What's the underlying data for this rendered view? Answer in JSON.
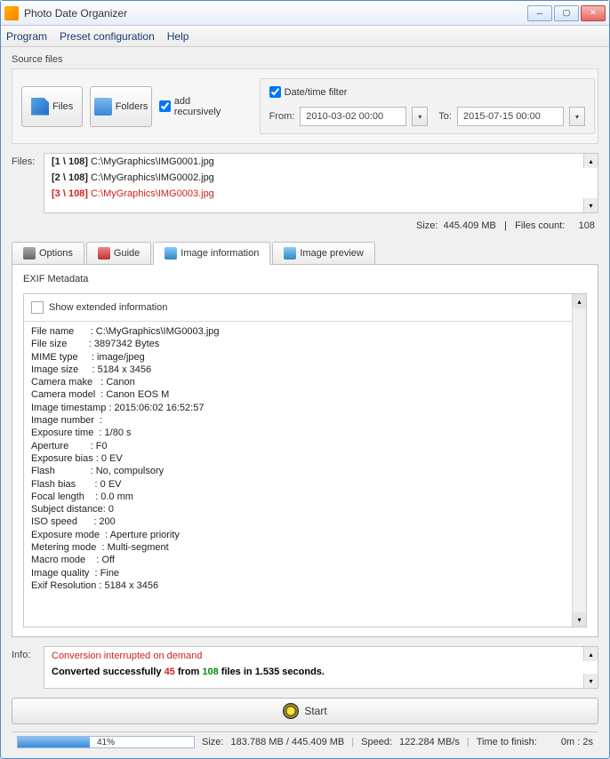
{
  "window": {
    "title": "Photo Date Organizer"
  },
  "menu": {
    "program": "Program",
    "preset": "Preset configuration",
    "help": "Help"
  },
  "source": {
    "label": "Source files",
    "files_btn": "Files",
    "folders_btn": "Folders",
    "recursive": "add recursively",
    "filter_label": "Date/time filter",
    "from_label": "From:",
    "from_value": "2010-03-02 00:00",
    "to_label": "To:",
    "to_value": "2015-07-15 00:00"
  },
  "files": {
    "label": "Files:",
    "items": [
      {
        "idx": "[1 \\ 108]",
        "path": " C:\\MyGraphics\\IMG0001.jpg"
      },
      {
        "idx": "[2 \\ 108]",
        "path": " C:\\MyGraphics\\IMG0002.jpg"
      },
      {
        "idx": "[3 \\ 108]",
        "path": " C:\\MyGraphics\\IMG0003.jpg"
      }
    ],
    "size_label": "Size:",
    "size_value": "445.409 MB",
    "count_label": "Files count:",
    "count_value": "108"
  },
  "tabs": {
    "options": "Options",
    "guide": "Guide",
    "info": "Image information",
    "preview": "Image preview"
  },
  "exif": {
    "title": "EXIF Metadata",
    "extended": "Show extended information",
    "lines": "File name      : C:\\MyGraphics\\IMG0003.jpg\nFile size        : 3897342 Bytes\nMIME type     : image/jpeg\nImage size     : 5184 x 3456\nCamera make   : Canon\nCamera model  : Canon EOS M\nImage timestamp : 2015:06:02 16:52:57\nImage number  :\nExposure time  : 1/80 s\nAperture        : F0\nExposure bias : 0 EV\nFlash             : No, compulsory\nFlash bias       : 0 EV\nFocal length    : 0.0 mm\nSubject distance: 0\nISO speed      : 200\nExposure mode  : Aperture priority\nMetering mode  : Multi-segment\nMacro mode    : Off\nImage quality  : Fine\nExif Resolution : 5184 x 3456"
  },
  "info": {
    "label": "Info:",
    "line1": "Conversion interrupted on demand",
    "line2_a": "Converted successfully ",
    "line2_red": "45",
    "line2_b": " from ",
    "line2_green": "108",
    "line2_c": " files in 1.535 seconds."
  },
  "start": {
    "label": "Start"
  },
  "status": {
    "pct": "41%",
    "pct_val": 41,
    "size_label": "Size:",
    "size_value": "183.788 MB  /  445.409 MB",
    "speed_label": "Speed:",
    "speed_value": "122.284 MB/s",
    "ttf_label": "Time to finish:",
    "ttf_value": "0m : 2s"
  }
}
